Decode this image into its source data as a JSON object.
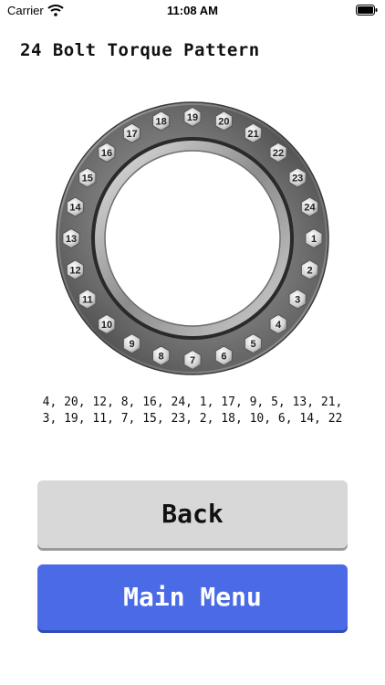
{
  "status_bar": {
    "carrier": "Carrier",
    "time": "11:08 AM"
  },
  "page": {
    "title": "24 Bolt Torque Pattern"
  },
  "flange": {
    "bolt_labels": [
      "1",
      "2",
      "3",
      "4",
      "5",
      "6",
      "7",
      "8",
      "9",
      "10",
      "11",
      "12",
      "13",
      "14",
      "15",
      "16",
      "17",
      "18",
      "19",
      "20",
      "21",
      "22",
      "23",
      "24"
    ]
  },
  "sequence": {
    "line1": "4, 20, 12, 8, 16, 24, 1, 17, 9, 5, 13, 21,",
    "line2": "3, 19, 11, 7, 15, 23, 2, 18, 10, 6, 14, 22"
  },
  "buttons": {
    "back_label": "Back",
    "main_menu_label": "Main Menu"
  },
  "colors": {
    "main_menu_button": "#4a6ae6",
    "back_button": "#d8d8d8"
  }
}
